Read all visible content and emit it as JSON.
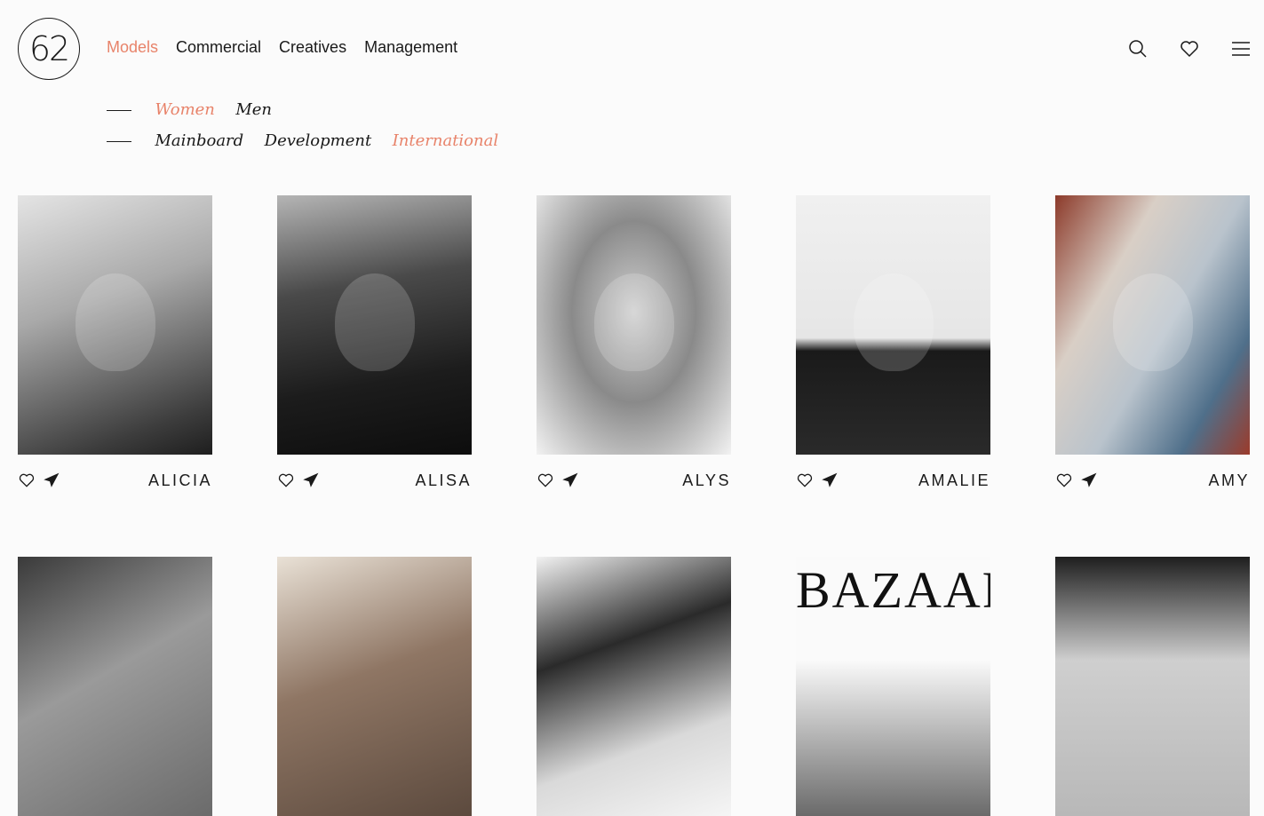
{
  "logo": {
    "text": "62"
  },
  "nav": {
    "items": [
      {
        "label": "Models",
        "active": true
      },
      {
        "label": "Commercial",
        "active": false
      },
      {
        "label": "Creatives",
        "active": false
      },
      {
        "label": "Management",
        "active": false
      }
    ]
  },
  "header_icons": [
    "search-icon",
    "heart-icon",
    "menu-icon"
  ],
  "gender_filter": [
    {
      "label": "Women",
      "active": true
    },
    {
      "label": "Men",
      "active": false
    }
  ],
  "board_filter": [
    {
      "label": "Mainboard",
      "active": false
    },
    {
      "label": "Development",
      "active": false
    },
    {
      "label": "International",
      "active": true
    }
  ],
  "models": [
    {
      "name": "ALICIA"
    },
    {
      "name": "ALISA"
    },
    {
      "name": "ALYS"
    },
    {
      "name": "AMALIE"
    },
    {
      "name": "AMY"
    }
  ],
  "next_row_cover_text": "BAZAAR",
  "colors": {
    "accent": "#e8836a",
    "text": "#1a1a1a",
    "background": "#fbfbfb"
  }
}
